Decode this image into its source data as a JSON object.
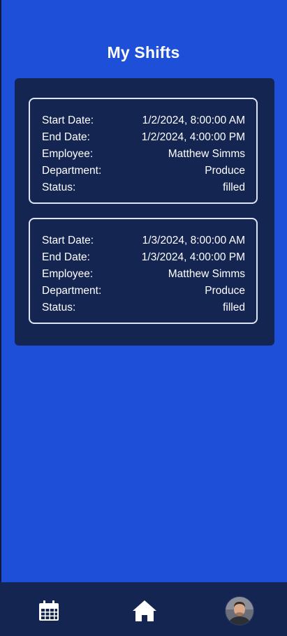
{
  "page": {
    "title": "My Shifts"
  },
  "labels": {
    "start_date": "Start Date:",
    "end_date": "End Date:",
    "employee": "Employee:",
    "department": "Department:",
    "status": "Status:"
  },
  "shifts": [
    {
      "start_date": "1/2/2024, 8:00:00 AM",
      "end_date": "1/2/2024, 4:00:00 PM",
      "employee": "Matthew Simms",
      "department": "Produce",
      "status": "filled"
    },
    {
      "start_date": "1/3/2024, 8:00:00 AM",
      "end_date": "1/3/2024, 4:00:00 PM",
      "employee": "Matthew Simms",
      "department": "Produce",
      "status": "filled"
    }
  ],
  "nav": {
    "items": [
      {
        "icon": "calendar-icon"
      },
      {
        "icon": "home-icon"
      },
      {
        "icon": "profile-avatar"
      }
    ]
  },
  "colors": {
    "background": "#1E4FD8",
    "panel": "#152552",
    "card_border": "#dfe5f5",
    "text": "#ffffff"
  }
}
